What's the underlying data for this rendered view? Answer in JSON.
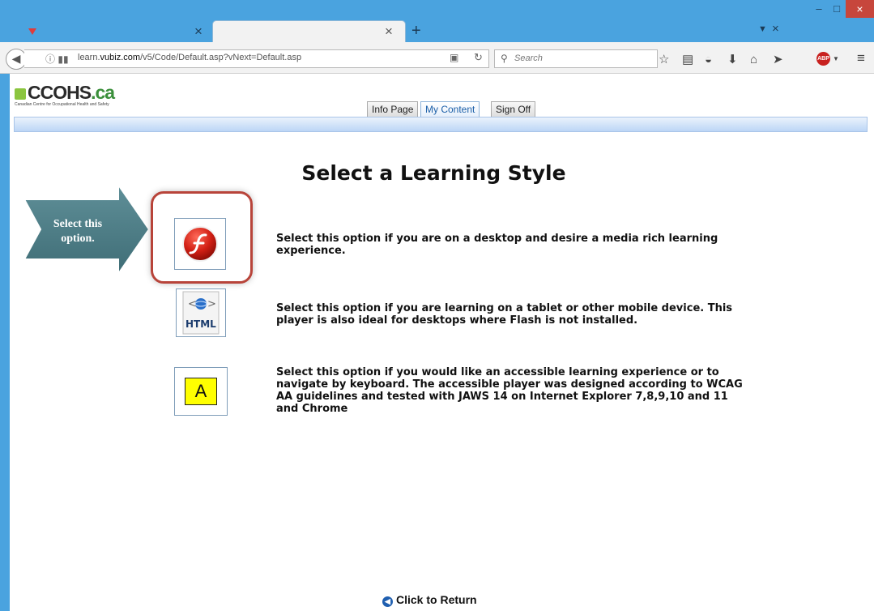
{
  "browser": {
    "tab_close_glyph": "×",
    "new_tab_glyph": "+",
    "url_prefix": "learn.",
    "url_domain": "vubiz.com",
    "url_path": "/v5/Code/Default.asp?vNext=Default.asp",
    "search_placeholder": "Search",
    "abp_label": "ABP",
    "window": {
      "minimize": "–",
      "maximize": "□",
      "close": "×"
    }
  },
  "site": {
    "logo_main": "CCOHS",
    "logo_ext": ".ca",
    "logo_sub": "Canadian Centre for Occupational Health and Safety"
  },
  "nav_tabs": [
    {
      "label": "Info Page",
      "active": false
    },
    {
      "label": "My Content",
      "active": true
    },
    {
      "label": "Sign Off",
      "active": false
    }
  ],
  "heading": "Select a Learning Style",
  "callout": {
    "line1": "Select this",
    "line2": "option."
  },
  "options": [
    {
      "icon": "flash-player-icon",
      "description": "Select this option if you are on a desktop and desire a media rich learning experience."
    },
    {
      "icon": "html-player-icon",
      "icon_label": "HTML",
      "description": "Select this option if you are learning on a tablet or other mobile device. This player is also ideal for desktops where Flash is not installed."
    },
    {
      "icon": "accessible-player-icon",
      "icon_label": "A",
      "description": "Select this option if you would like an accessible learning experience or to navigate by keyboard. The accessible player was designed according to WCAG AA guidelines and tested with JAWS 14 on Internet Explorer 7,8,9,10 and 11 and Chrome"
    }
  ],
  "return_label": "Click to Return",
  "colors": {
    "chrome_blue": "#4aa3df",
    "highlight_ring": "#b8443a",
    "callout_arrow": "#4a7c86",
    "active_tab_text": "#1c5fa8"
  }
}
